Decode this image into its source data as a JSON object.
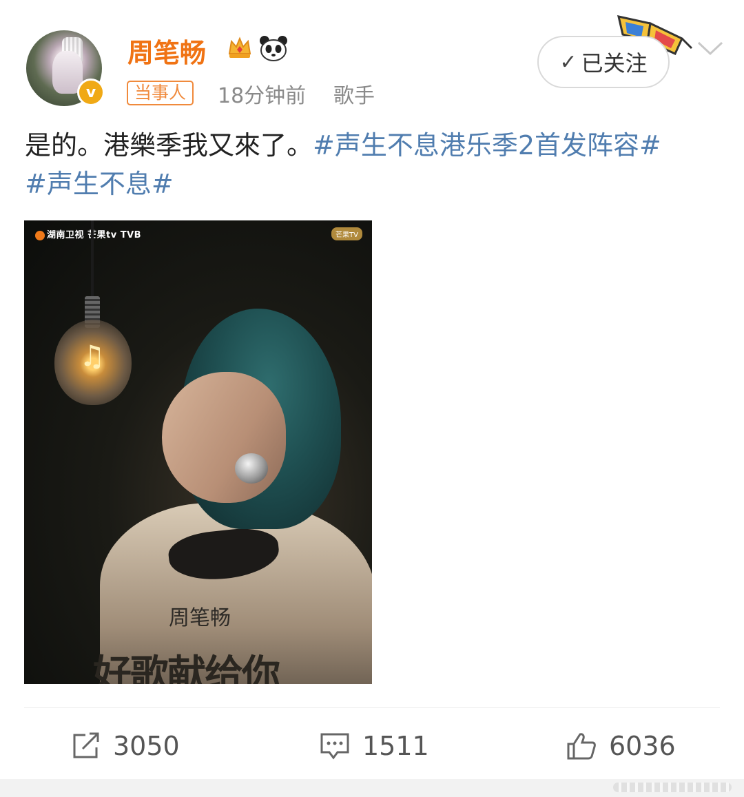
{
  "post": {
    "author": {
      "name": "周笔畅",
      "tag": "当事人",
      "time_ago": "18分钟前",
      "role": "歌手",
      "avatar": "user-avatar",
      "verified": "v"
    },
    "follow_button": {
      "check": "✓",
      "label": "已关注"
    },
    "content": {
      "text": "是的。港樂季我又來了。",
      "hashtag1": "#声生不息港乐季2首发阵容#",
      "hashtag2": "#声生不息#"
    },
    "image": {
      "logos": "湖南卫视  芒果tv  TVB",
      "badge": "芒果TV",
      "artist_name": "周笔畅",
      "show_title": "好歌献给你"
    },
    "actions": {
      "repost_count": "3050",
      "comment_count": "1511",
      "like_count": "6036"
    }
  },
  "colors": {
    "username": "#f07314",
    "hashtag": "#507daf",
    "tag_border": "#f08a3c",
    "meta": "#8a8a8a"
  }
}
